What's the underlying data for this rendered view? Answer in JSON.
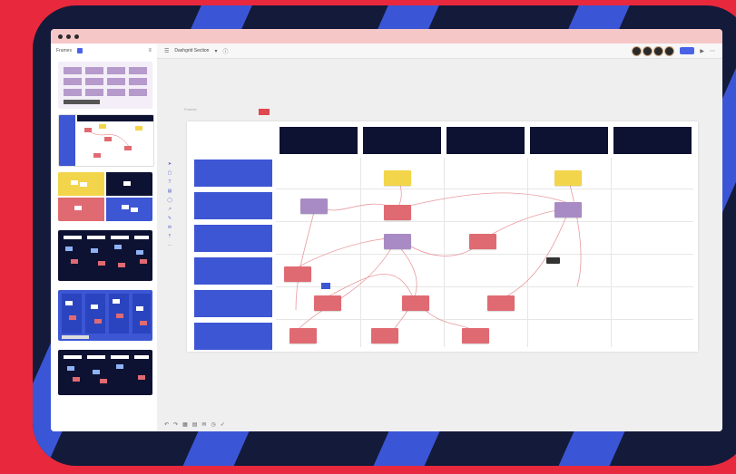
{
  "window": {
    "title": ""
  },
  "sidebar": {
    "label": "Frames",
    "count": "",
    "thumbnails": [
      "",
      "",
      "",
      "",
      "",
      ""
    ]
  },
  "toolbar": {
    "board_name": "Dashgrid Section"
  },
  "canvas": {
    "frame_label": "Frames"
  },
  "matrix": {
    "columns": [
      "",
      "",
      "",
      "",
      ""
    ],
    "rows": [
      "",
      "",
      "",
      "",
      "",
      ""
    ]
  },
  "bottom": {
    "zoom": ""
  },
  "colors": {
    "background": "#e8293d",
    "frame": "#141a3a",
    "stripe": "#3a56d6",
    "row_header": "#3d56d4",
    "column_header": "#0d1233",
    "sticky_red": "#e06a72",
    "sticky_yellow": "#f2d54a",
    "sticky_purple": "#a88bc4",
    "accent": "#4a63e6"
  }
}
